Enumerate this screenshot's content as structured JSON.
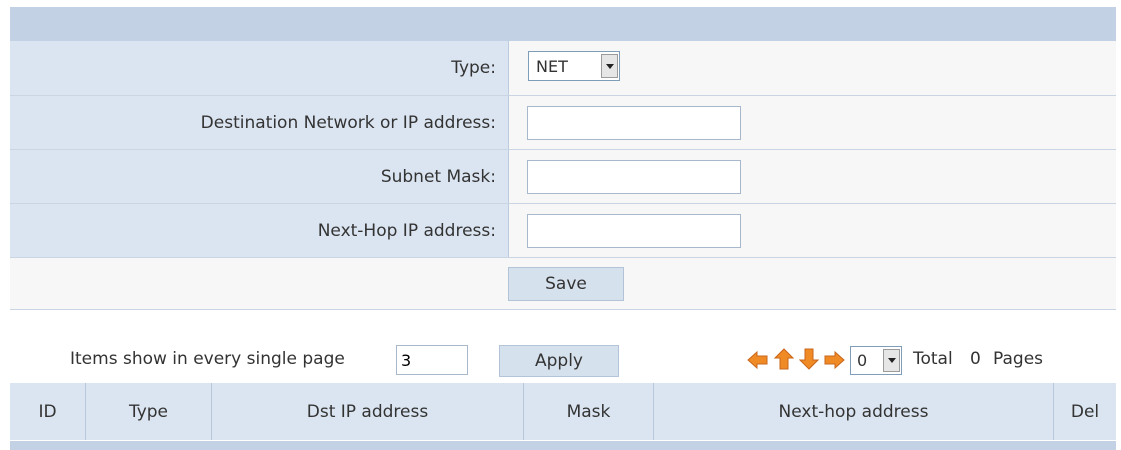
{
  "form": {
    "type_label": "Type:",
    "type_value": "NET",
    "dest_label": "Destination Network or IP address:",
    "dest_value": "",
    "mask_label": "Subnet Mask:",
    "mask_value": "",
    "nexthop_label": "Next-Hop IP address:",
    "nexthop_value": "",
    "save_label": "Save"
  },
  "pager": {
    "items_label": "Items show in every single page",
    "items_value": "3",
    "apply_label": "Apply",
    "page_select_value": "0",
    "total_label": "Total",
    "total_value": "0",
    "pages_label": "Pages"
  },
  "table": {
    "headers": [
      "ID",
      "Type",
      "Dst IP address",
      "Mask",
      "Next-hop address",
      "Del"
    ]
  },
  "icons": {
    "first": "arrow-left-icon",
    "prev": "arrow-up-icon",
    "next": "arrow-down-icon",
    "last": "arrow-right-icon",
    "color": "#f08a24"
  }
}
